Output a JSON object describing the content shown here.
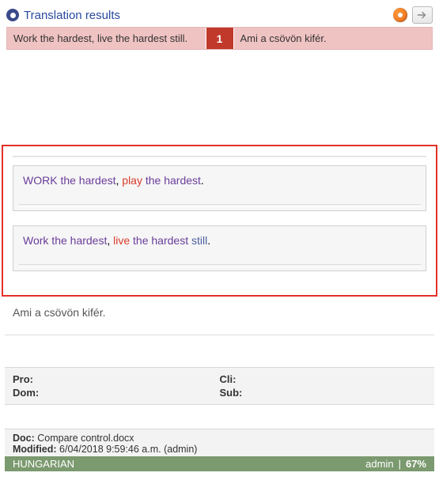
{
  "header": {
    "title": "Translation results"
  },
  "results": [
    {
      "source": "Work the hardest, live the hardest still.",
      "index": "1",
      "target": "Ami a csövön kifér."
    }
  ],
  "diffs": [
    {
      "tokens": [
        {
          "t": "WORK",
          "c": "keep"
        },
        {
          "t": " the hardest",
          "c": "keep"
        },
        {
          "t": ", ",
          "c": "plain"
        },
        {
          "t": "play",
          "c": "change"
        },
        {
          "t": " the hardest",
          "c": "keep"
        },
        {
          "t": ".",
          "c": "plain"
        }
      ]
    },
    {
      "tokens": [
        {
          "t": "Work",
          "c": "keep"
        },
        {
          "t": " the hardest",
          "c": "keep"
        },
        {
          "t": ", ",
          "c": "plain"
        },
        {
          "t": "live",
          "c": "change"
        },
        {
          "t": " the hardest ",
          "c": "keep"
        },
        {
          "t": "still",
          "c": "change2"
        },
        {
          "t": ".",
          "c": "plain"
        }
      ]
    }
  ],
  "target_plain": "Ami a csövön kifér.",
  "meta": {
    "pro_label": "Pro:",
    "dom_label": "Dom:",
    "cli_label": "Cli:",
    "sub_label": "Sub:",
    "pro": "",
    "dom": "",
    "cli": "",
    "sub": ""
  },
  "doc": {
    "doc_label": "Doc:",
    "doc_name": "Compare control.docx",
    "mod_label": "Modified:",
    "mod_value": "6/04/2018 9:59:46 a.m. (admin)"
  },
  "status": {
    "language": "HUNGARIAN",
    "user": "admin",
    "sep": "|",
    "percent": "67%"
  }
}
